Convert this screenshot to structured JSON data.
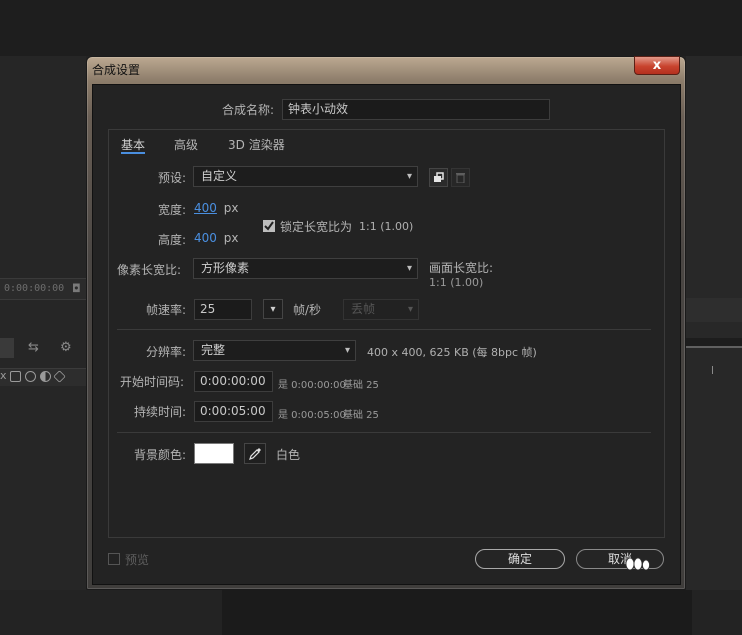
{
  "background": {
    "timecode": "0:00:00:00"
  },
  "window": {
    "title": "合成设置",
    "close_label": "x"
  },
  "form": {
    "comp_name_label": "合成名称:",
    "comp_name_value": "钟表小动效",
    "tabs": [
      {
        "label": "基本",
        "active": true
      },
      {
        "label": "高级",
        "active": false
      },
      {
        "label": "3D 渲染器",
        "active": false
      }
    ],
    "preset": {
      "label": "预设:",
      "value": "自定义"
    },
    "width": {
      "label": "宽度:",
      "value": "400",
      "unit": "px"
    },
    "height": {
      "label": "高度:",
      "value": "400",
      "unit": "px"
    },
    "lock_aspect": {
      "label": "锁定长宽比为",
      "ratio": "1:1 (1.00)",
      "checked": true
    },
    "pixel_aspect": {
      "label": "像素长宽比:",
      "value": "方形像素"
    },
    "frame_aspect": {
      "label": "画面长宽比:",
      "value": "1:1 (1.00)"
    },
    "frame_rate": {
      "label": "帧速率:",
      "value": "25",
      "unit": "帧/秒",
      "drop_frame": "丢帧"
    },
    "resolution": {
      "label": "分辨率:",
      "value": "完整",
      "info": "400 x 400, 625 KB (每 8bpc 帧)"
    },
    "start_timecode": {
      "label": "开始时间码:",
      "value": "0:00:00:00",
      "note_is": "是 0:00:00:00",
      "note_base": "基础 25"
    },
    "duration": {
      "label": "持续时间:",
      "value": "0:00:05:00",
      "note_is": "是 0:00:05:00",
      "note_base": "基础 25"
    },
    "bg_color": {
      "label": "背景颜色:",
      "name": "白色",
      "swatch": "#ffffff"
    }
  },
  "footer": {
    "preview_label": "预览",
    "ok_label": "确定",
    "cancel_label": "取消"
  },
  "colors": {
    "accent_blue": "#4a8fe0",
    "close_red": "#c8432e"
  }
}
